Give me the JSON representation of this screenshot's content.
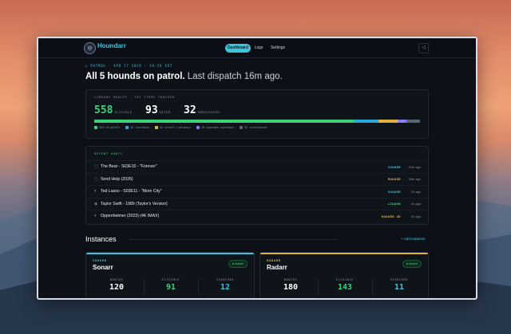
{
  "app": {
    "name": "Houndarr",
    "logo_glyph": "◎"
  },
  "nav": [
    {
      "label": "Dashboard",
      "active": true
    },
    {
      "label": "Logs",
      "active": false
    },
    {
      "label": "Settings",
      "active": false
    }
  ],
  "topbar": {
    "icon": "collapse-icon",
    "glyph": "◁"
  },
  "header": {
    "patrol_line": "◎ PATROL · APR 27 2026 · 18:28 EDT",
    "headline_main": "All 5 hounds on patrol.",
    "headline_sub": "Last dispatch 16m ago."
  },
  "library": {
    "title": "LIBRARY HEALTH · 701 ITEMS TRACKED",
    "stats": [
      {
        "value": "558",
        "label": "ELIGIBLE"
      },
      {
        "value": "93",
        "label": "GATED"
      },
      {
        "value": "32",
        "label": "UNRELEASED"
      }
    ],
    "bar": [
      {
        "fraction": 0.796,
        "color": "#3fd17a"
      },
      {
        "fraction": 0.076,
        "color": "#2aa8d8"
      },
      {
        "fraction": 0.06,
        "color": "#e3b341"
      },
      {
        "fraction": 0.026,
        "color": "#8b7cf6"
      },
      {
        "fraction": 0.042,
        "color": "#5b6473"
      }
    ],
    "legend": [
      {
        "text": "558 eligible",
        "color": "#3fd17a"
      },
      {
        "text": "33 cooldown",
        "color": "#2aa8d8"
      },
      {
        "text": "42 cutoff cooldown",
        "color": "#e3b341"
      },
      {
        "text": "18 upgrade cooldown",
        "color": "#8b7cf6"
      },
      {
        "text": "32 unreleased",
        "color": "#5b6473"
      }
    ]
  },
  "recent_hunts": {
    "title": "RECENT HUNTS",
    "items": [
      {
        "icon_glyph": "▢",
        "title": "The Bear - S03E10 - \"Forever\"",
        "source": "SONARR",
        "source_color": "#3cc4dd",
        "time": "12m ago"
      },
      {
        "icon_glyph": "▢",
        "title": "Send Help (2026)",
        "source": "RADARR",
        "source_color": "#e3b341",
        "time": "35m ago"
      },
      {
        "icon_glyph": "▾",
        "title": "Ted Lasso - S03E11 - \"Mom City\"",
        "source": "SONARR",
        "source_color": "#3cc4dd",
        "time": "1h ago"
      },
      {
        "icon_glyph": "◉",
        "title": "Taylor Swift - 1989 (Taylor's Version)",
        "source": "LIDARR",
        "source_color": "#3fd17a",
        "time": "1h ago"
      },
      {
        "icon_glyph": "▾",
        "title": "Oppenheimer (2023) (4K IMAX)",
        "source": "RADARR 4K",
        "source_color": "#e3b341",
        "time": "2h ago"
      }
    ]
  },
  "instances": {
    "heading": "Instances",
    "add_label": "+ Add Instance",
    "cards": [
      {
        "tag": "SONARR",
        "name": "Sonarr",
        "status": "● Active",
        "accent": "#3cc4dd",
        "stats": [
          {
            "label": "WANTED",
            "value": "120",
            "color": "#ffffff"
          },
          {
            "label": "ELIGIBLE",
            "value": "91",
            "color": "#3fd17a"
          },
          {
            "label": "SEARCHED",
            "value": "12",
            "color": "#3cc4dd"
          }
        ]
      },
      {
        "tag": "RADARR",
        "name": "Radarr",
        "status": "● Active",
        "accent": "#e3b341",
        "stats": [
          {
            "label": "WANTED",
            "value": "180",
            "color": "#ffffff"
          },
          {
            "label": "ELIGIBLE",
            "value": "143",
            "color": "#3fd17a"
          },
          {
            "label": "SEARCHED",
            "value": "11",
            "color": "#3cc4dd"
          }
        ]
      }
    ]
  }
}
